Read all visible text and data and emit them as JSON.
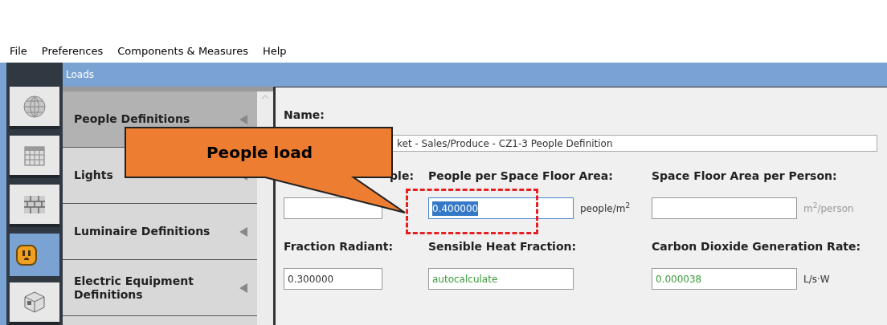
{
  "menu": [
    "File",
    "Preferences",
    "Components & Measures",
    "Help"
  ],
  "nav_tabs": [
    {
      "kind": "globe",
      "selected": false
    },
    {
      "kind": "calendar",
      "selected": false
    },
    {
      "kind": "bricks",
      "selected": false
    },
    {
      "kind": "outlet",
      "selected": true
    },
    {
      "kind": "cube",
      "selected": false
    }
  ],
  "panel_title": "Loads",
  "sidebar": {
    "items": [
      {
        "label": "People Definitions",
        "selected": true
      },
      {
        "label": "Lights",
        "selected": false
      },
      {
        "label": "Luminaire Definitions",
        "selected": false
      },
      {
        "label": "Electric Equipment Definitions",
        "selected": false
      }
    ]
  },
  "form": {
    "name_label": "Name:",
    "name_value": "ket - Sales/Produce - CZ1-3 People Definition",
    "rows": [
      {
        "fields": [
          {
            "label": "ple:",
            "highlighted": false
          },
          {
            "label": "People per Space Floor Area:",
            "value": "0.400000",
            "unit": "people/m$^{2}$",
            "highlighted": true
          },
          {
            "label": "Space Floor Area per Person:",
            "unit": "m$^{2}$/person",
            "highlighted": false
          }
        ]
      },
      {
        "fields": [
          {
            "label": "Fraction Radiant:",
            "value": "0.300000",
            "kind": "plain",
            "highlighted": false
          },
          {
            "label": "Sensible Heat Fraction:",
            "value": "autocalculate",
            "kind": "calculated",
            "highlighted": false
          },
          {
            "label": "Carbon Dioxide Generation Rate:",
            "value": "0.000038",
            "kind": "calculated",
            "unit": "L/s·W",
            "highlighted": false
          }
        ]
      }
    ]
  },
  "annotation": {
    "text": "People load"
  }
}
